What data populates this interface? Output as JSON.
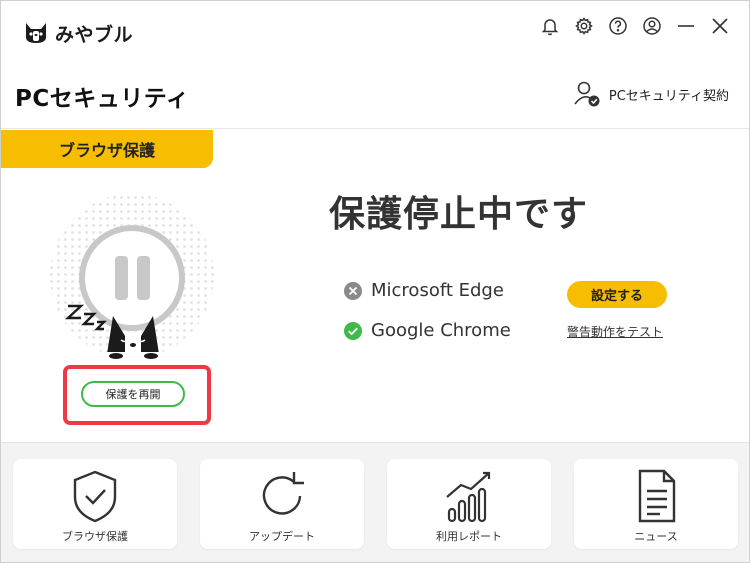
{
  "app": {
    "logo_text": "みやブル"
  },
  "titlebar": {
    "icons": [
      "bell-icon",
      "gear-icon",
      "help-icon",
      "account-icon",
      "minimize-icon",
      "close-icon"
    ]
  },
  "header": {
    "title": "PCセキュリティ",
    "contract_label": "PCセキュリティ契約"
  },
  "panel": {
    "tab_label": "ブラウザ保護",
    "status_heading": "保護停止中です",
    "resume_button_label": "保護を再開",
    "browsers": [
      {
        "name": "Microsoft Edge",
        "status": "disabled",
        "status_icon": "x-circle-icon"
      },
      {
        "name": "Google Chrome",
        "status": "enabled",
        "status_icon": "check-circle-icon"
      }
    ],
    "setup_button_label": "設定する",
    "test_link_label": "警告動作をテスト"
  },
  "tiles": [
    {
      "label": "ブラウザ保護",
      "icon": "shield-check-icon"
    },
    {
      "label": "アップデート",
      "icon": "refresh-icon"
    },
    {
      "label": "利用レポート",
      "icon": "bar-chart-icon"
    },
    {
      "label": "ニュース",
      "icon": "document-icon"
    }
  ],
  "colors": {
    "accent_yellow": "#f7bd00",
    "highlight_red": "#ee3a45",
    "success_green": "#3fba4a",
    "disabled_gray": "#8a8a8a"
  }
}
